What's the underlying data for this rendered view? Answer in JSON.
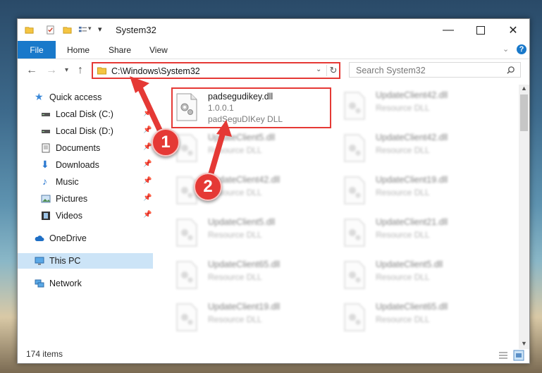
{
  "window": {
    "title": "System32",
    "minimize_icon": "minimize",
    "maximize_icon": "maximize",
    "close_icon": "close"
  },
  "ribbon": {
    "tabs": [
      "File",
      "Home",
      "Share",
      "View"
    ]
  },
  "address_bar": {
    "path": "C:\\Windows\\System32",
    "search_placeholder": "Search System32"
  },
  "nav_pane": {
    "items": [
      {
        "label": "Quick access",
        "icon": "star-icon",
        "pinned": false
      },
      {
        "label": "Local Disk (C:)",
        "icon": "drive-icon",
        "pinned": true
      },
      {
        "label": "Local Disk (D:)",
        "icon": "drive-icon",
        "pinned": true
      },
      {
        "label": "Documents",
        "icon": "documents-icon",
        "pinned": true
      },
      {
        "label": "Downloads",
        "icon": "download-icon",
        "pinned": true
      },
      {
        "label": "Music",
        "icon": "music-icon",
        "pinned": true
      },
      {
        "label": "Pictures",
        "icon": "pictures-icon",
        "pinned": true
      },
      {
        "label": "Videos",
        "icon": "videos-icon",
        "pinned": true
      },
      {
        "label": "OneDrive",
        "icon": "cloud-icon",
        "pinned": false
      },
      {
        "label": "This PC",
        "icon": "computer-icon",
        "pinned": false,
        "selected": true
      },
      {
        "label": "Network",
        "icon": "network-icon",
        "pinned": false
      }
    ]
  },
  "files": {
    "highlighted": {
      "name": "padsegudikey.dll",
      "version": "1.0.0.1",
      "description": "padSeguDIKey DLL"
    },
    "left_column": [
      {
        "name": "UpdateClient5.dll",
        "description": "Resource DLL"
      },
      {
        "name": "UpdateClient42.dll",
        "description": "Resource DLL"
      },
      {
        "name": "UpdateClient5.dll",
        "description": "Resource DLL"
      },
      {
        "name": "UpdateClient65.dll",
        "description": "Resource DLL"
      },
      {
        "name": "UpdateClient19.dll",
        "description": "Resource DLL"
      }
    ],
    "right_column": [
      {
        "name": "UpdateClient42.dll",
        "description": "Resource DLL"
      },
      {
        "name": "UpdateClient42.dll",
        "description": "Resource DLL"
      },
      {
        "name": "UpdateClient19.dll",
        "description": "Resource DLL"
      },
      {
        "name": "UpdateClient21.dll",
        "description": "Resource DLL"
      },
      {
        "name": "UpdateClient5.dll",
        "description": "Resource DLL"
      },
      {
        "name": "UpdateClient65.dll",
        "description": "Resource DLL"
      }
    ]
  },
  "status": {
    "item_count": "174 items"
  },
  "annotations": {
    "step1": "1",
    "step2": "2",
    "color": "#e53935"
  }
}
